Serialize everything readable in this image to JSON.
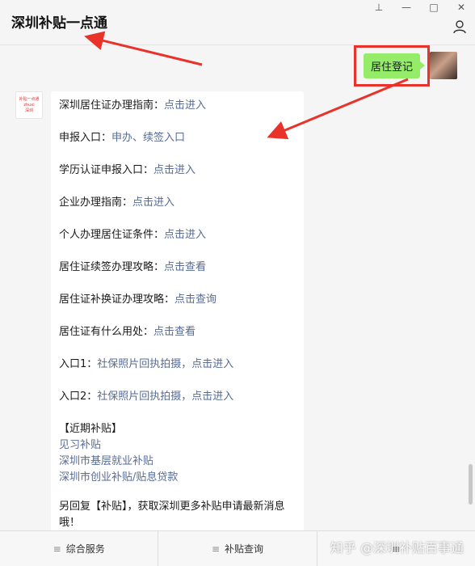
{
  "header": {
    "title": "深圳补贴一点通"
  },
  "outgoing": {
    "text": "居住登记"
  },
  "incoming": {
    "bot_avatar_lines": [
      "补贴一点通",
      "zhuxi",
      "深圳"
    ],
    "items": [
      {
        "label": "深圳居住证办理指南：",
        "link": "点击进入"
      },
      {
        "label": "申报入口：",
        "link": "申办、续签入口"
      },
      {
        "label": "学历认证申报入口：",
        "link": "点击进入"
      },
      {
        "label": "企业办理指南：",
        "link": "点击进入"
      },
      {
        "label": "个人办理居住证条件：",
        "link": "点击进入"
      },
      {
        "label": "居住证续签办理攻略：",
        "link": "点击查看"
      },
      {
        "label": "居住证补换证办理攻略：",
        "link": "点击查询"
      },
      {
        "label": "居住证有什么用处：",
        "link": "点击查看"
      },
      {
        "label": "入口1：",
        "link": "社保照片回执拍摄，点击进入"
      },
      {
        "label": "入口2：",
        "link": "社保照片回执拍摄，点击进入"
      }
    ],
    "recent_title": "【近期补贴】",
    "recent_links": [
      "见习补贴",
      "深圳市基层就业补贴",
      "深圳市创业补贴/贴息贷款"
    ],
    "footer_text": "另回复【补贴】，获取深圳更多补贴申请最新消息哦！"
  },
  "bottom_menu": [
    {
      "label": "综合服务",
      "icon": "≡"
    },
    {
      "label": "补贴查询",
      "icon": "≡"
    },
    {
      "label": "≡",
      "icon": ""
    }
  ],
  "watermark": "知乎 @深圳补贴百事通",
  "window_controls": [
    "⊥",
    "—",
    "□",
    "✕"
  ]
}
